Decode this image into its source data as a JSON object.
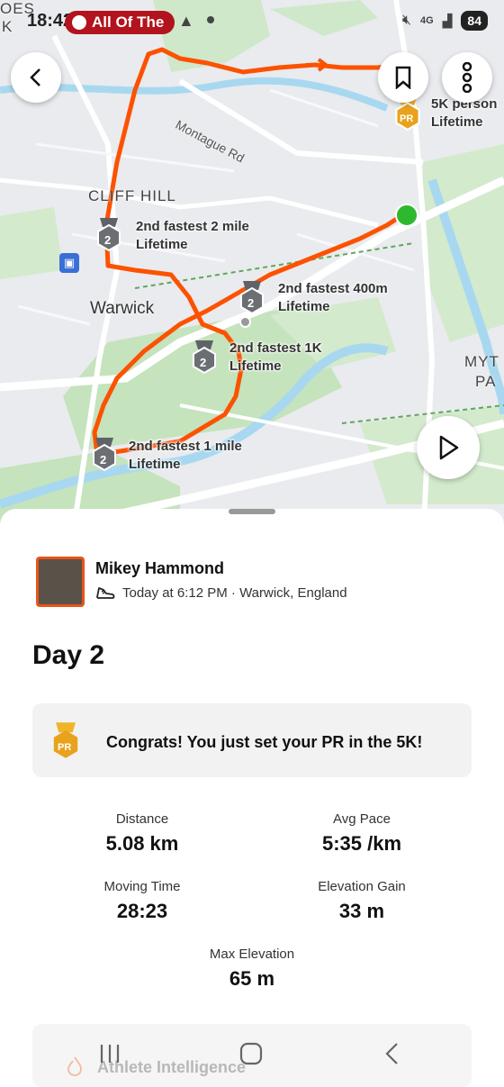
{
  "status_bar": {
    "time": "18:42",
    "music_pill": "All Of The",
    "network": "4G",
    "battery": "84"
  },
  "map": {
    "places": {
      "cliff_hill": "CLIFF HILL",
      "warwick": "Warwick",
      "myt_top": "MYT",
      "myt_bottom": "PA",
      "oes": "OES",
      "k": "K"
    },
    "road_label": "Montague Rd",
    "achievements": [
      {
        "line1": "2nd fastest 2 mile",
        "line2": "Lifetime"
      },
      {
        "line1": "2nd fastest 400m",
        "line2": "Lifetime"
      },
      {
        "line1": "2nd fastest 1K",
        "line2": "Lifetime"
      },
      {
        "line1": "2nd fastest 1 mile",
        "line2": "Lifetime"
      },
      {
        "line1": "5K person",
        "line2": "Lifetime"
      }
    ],
    "medal_rank": "2",
    "pr_badge": "PR",
    "colors": {
      "route": "#fc5200",
      "start": "#2eb82e",
      "water": "#a8d8f0",
      "green": "#c8e6c2"
    }
  },
  "activity": {
    "athlete": "Mikey Hammond",
    "meta": "Today at 6:12 PM · Warwick, England",
    "title": "Day 2",
    "pr_message": "Congrats! You just set your PR in the 5K!",
    "pr_badge": "PR",
    "stats": {
      "distance": {
        "label": "Distance",
        "value": "5.08 km"
      },
      "avg_pace": {
        "label": "Avg Pace",
        "value": "5:35 /km"
      },
      "moving_time": {
        "label": "Moving Time",
        "value": "28:23"
      },
      "elevation_gain": {
        "label": "Elevation Gain",
        "value": "33 m"
      },
      "max_elevation": {
        "label": "Max Elevation",
        "value": "65 m"
      }
    },
    "insights_label": "Athlete Intelligence"
  }
}
